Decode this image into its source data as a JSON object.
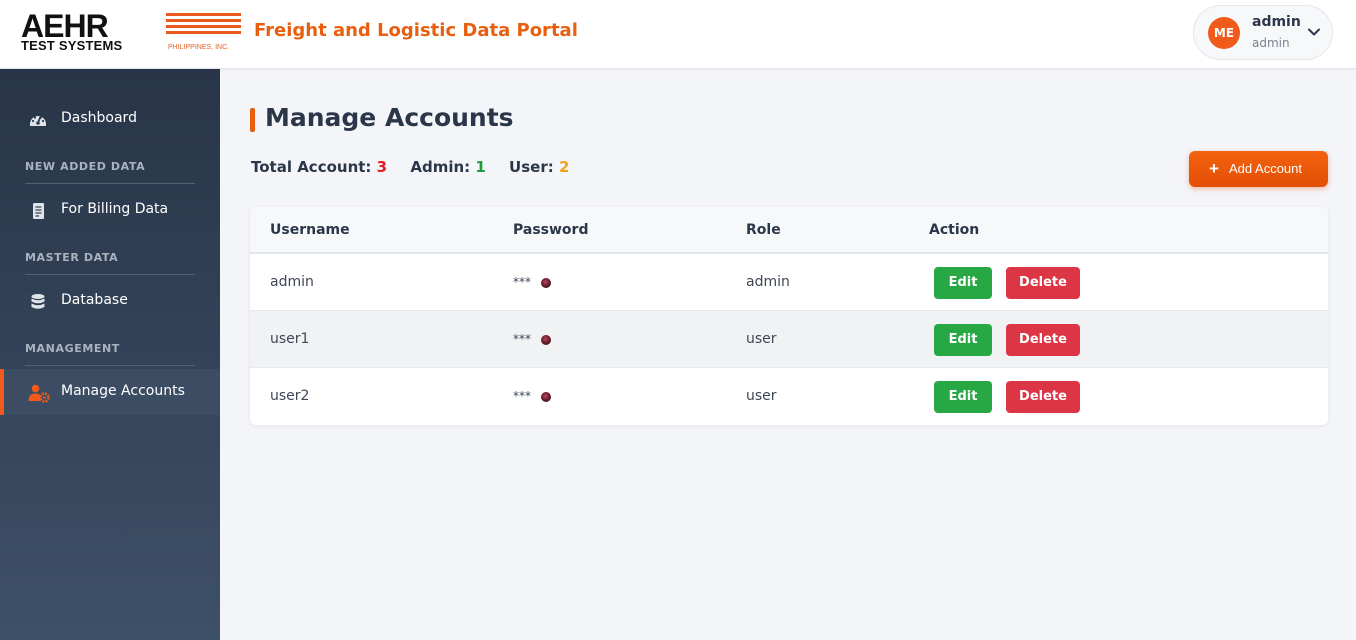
{
  "header": {
    "logo": {
      "brand": "AEHR",
      "sub": "TEST SYSTEMS",
      "region": "PHILIPPINES, INC."
    },
    "app_title": "Freight and Logistic Data Portal",
    "user": {
      "initials": "ME",
      "name": "admin",
      "role": "admin"
    }
  },
  "sidebar": {
    "items": [
      {
        "label": "Dashboard",
        "icon": "gauge-icon"
      },
      {
        "section": "NEW ADDED DATA"
      },
      {
        "label": "For Billing Data",
        "icon": "document-icon"
      },
      {
        "section": "MASTER DATA"
      },
      {
        "label": "Database",
        "icon": "database-icon"
      },
      {
        "section": "MANAGEMENT"
      },
      {
        "label": "Manage Accounts",
        "icon": "user-gear-icon",
        "active": true
      }
    ]
  },
  "main": {
    "title": "Manage Accounts",
    "stats": {
      "total_label": "Total Account:",
      "total": "3",
      "admin_label": "Admin:",
      "admin": "1",
      "user_label": "User:",
      "user": "2"
    },
    "add_button": "Add Account",
    "table": {
      "columns": [
        "Username",
        "Password",
        "Role",
        "Action"
      ],
      "rows": [
        {
          "username": "admin",
          "password": "***",
          "role": "admin"
        },
        {
          "username": "user1",
          "password": "***",
          "role": "user"
        },
        {
          "username": "user2",
          "password": "***",
          "role": "user"
        }
      ],
      "edit_label": "Edit",
      "delete_label": "Delete"
    }
  },
  "colors": {
    "accent": "#f05a1a",
    "success": "#28a745",
    "danger": "#dc3545",
    "sidebar": "#2f3d52"
  }
}
